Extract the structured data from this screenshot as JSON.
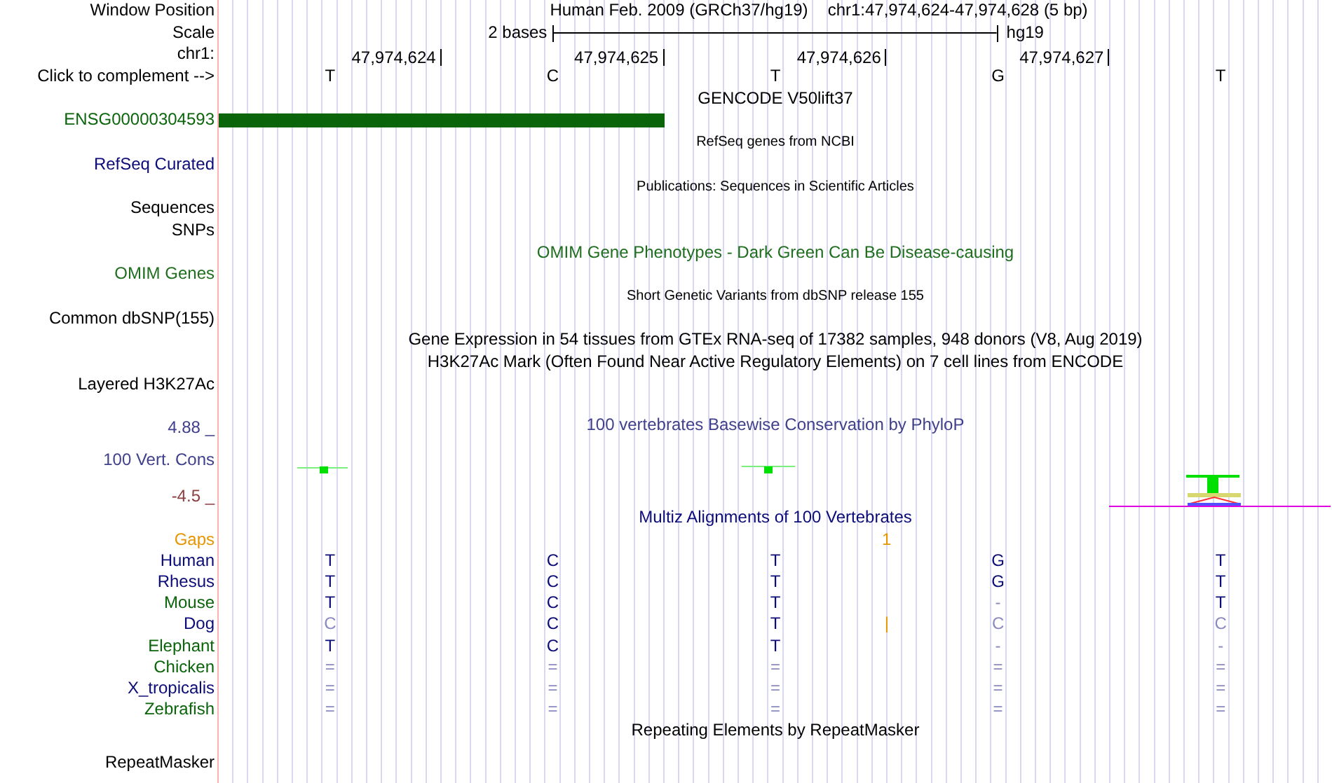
{
  "rows": [
    {
      "kind": "position",
      "label": "Window Position",
      "assembly": "Human Feb. 2009 (GRCh37/hg19)",
      "position": "chr1:47,974,624-47,974,628 (5 bp)"
    },
    {
      "kind": "scale",
      "label": "Scale",
      "span": "2 bases",
      "db": "hg19"
    },
    {
      "kind": "ruler",
      "label": "chr1:",
      "ticks": [
        "47,974,624",
        "47,974,625",
        "47,974,626",
        "47,974,627"
      ]
    },
    {
      "kind": "bases",
      "label": "Click to complement -->",
      "bases": [
        "T",
        "C",
        "T",
        "G",
        "T"
      ]
    },
    {
      "kind": "title",
      "text": "GENCODE V50lift37",
      "color": "#000000"
    },
    {
      "kind": "feature",
      "label": "ENSG00000304593",
      "color": "#0a640a",
      "level": 0.4
    },
    {
      "kind": "subtitle",
      "text": "RefSeq genes from NCBI"
    },
    {
      "kind": "label",
      "label": "RefSeq Curated",
      "color": "#0c0c78"
    },
    {
      "kind": "subtitle",
      "text": "Publications: Sequences in Scientific Articles"
    },
    {
      "kind": "label",
      "label": "Sequences",
      "color": "#000000"
    },
    {
      "kind": "label",
      "label": "SNPs",
      "color": "#000000"
    },
    {
      "kind": "title",
      "text": "OMIM Gene Phenotypes - Dark Green Can Be Disease-causing",
      "color": "#1e6e1e"
    },
    {
      "kind": "label",
      "label": "OMIM Genes",
      "color": "#1e6e1e"
    },
    {
      "kind": "subtitle",
      "text": "Short Genetic Variants from dbSNP release 155"
    },
    {
      "kind": "label",
      "label": "Common dbSNP(155)",
      "color": "#000000"
    },
    {
      "kind": "title",
      "text": "Gene Expression in 54 tissues from GTEx RNA-seq of 17382 samples, 948 donors (V8, Aug 2019)",
      "color": "#000000"
    },
    {
      "kind": "title",
      "text": "H3K27Ac Mark (Often Found Near Active Regulatory Elements) on 7 cell lines from ENCODE",
      "color": "#000000"
    },
    {
      "kind": "label",
      "label": "Layered H3K27Ac",
      "color": "#000000"
    },
    {
      "kind": "conservation",
      "label": "100 Vert. Cons",
      "color": "#40408c",
      "max": "4.88 _",
      "min": "-4.5 _",
      "text": "100 vertebrates Basewise Conservation by PhyloP"
    },
    {
      "kind": "title",
      "text": "Multiz Alignments of 100 Vertebrates",
      "color": "#0c0c78"
    },
    {
      "kind": "gaps",
      "label": "Gaps",
      "color": "#e69500",
      "insert": "1"
    },
    {
      "kind": "species",
      "label": "Human",
      "color": "#0c0c78",
      "bases": [
        {
          "text": "T",
          "faded": false
        },
        {
          "text": "C",
          "faded": false
        },
        {
          "text": "T",
          "faded": false
        },
        {
          "text": "G",
          "faded": false
        },
        {
          "text": "T",
          "faded": false
        }
      ]
    },
    {
      "kind": "species",
      "label": "Rhesus",
      "color": "#0c0c78",
      "bases": [
        {
          "text": "T",
          "faded": false
        },
        {
          "text": "C",
          "faded": false
        },
        {
          "text": "T",
          "faded": false
        },
        {
          "text": "G",
          "faded": false
        },
        {
          "text": "T",
          "faded": false
        }
      ]
    },
    {
      "kind": "species",
      "label": "Mouse",
      "color": "#0a640a",
      "bases": [
        {
          "text": "T",
          "faded": false
        },
        {
          "text": "C",
          "faded": false
        },
        {
          "text": "T",
          "faded": false
        },
        {
          "text": "-",
          "faded": true
        },
        {
          "text": "T",
          "faded": false
        }
      ]
    },
    {
      "kind": "species",
      "label": "Dog",
      "color": "#0c0c78",
      "insert": "|",
      "bases": [
        {
          "text": "C",
          "faded": true
        },
        {
          "text": "C",
          "faded": false
        },
        {
          "text": "T",
          "faded": false
        },
        {
          "text": "C",
          "faded": true
        },
        {
          "text": "C",
          "faded": true
        }
      ]
    },
    {
      "kind": "species",
      "label": "Elephant",
      "color": "#0a640a",
      "bases": [
        {
          "text": "T",
          "faded": false
        },
        {
          "text": "C",
          "faded": false
        },
        {
          "text": "T",
          "faded": false
        },
        {
          "text": "-",
          "faded": true
        },
        {
          "text": "-",
          "faded": true
        }
      ]
    },
    {
      "kind": "species",
      "label": "Chicken",
      "color": "#0a640a",
      "bases": [
        {
          "text": "=",
          "faded": true
        },
        {
          "text": "=",
          "faded": true
        },
        {
          "text": "=",
          "faded": true
        },
        {
          "text": "=",
          "faded": true
        },
        {
          "text": "=",
          "faded": true
        }
      ]
    },
    {
      "kind": "species",
      "label": "X_tropicalis",
      "color": "#0c0c78",
      "bases": [
        {
          "text": "=",
          "faded": true
        },
        {
          "text": "=",
          "faded": true
        },
        {
          "text": "=",
          "faded": true
        },
        {
          "text": "=",
          "faded": true
        },
        {
          "text": "=",
          "faded": true
        }
      ]
    },
    {
      "kind": "species",
      "label": "Zebrafish",
      "color": "#0a640a",
      "bases": [
        {
          "text": "=",
          "faded": true
        },
        {
          "text": "=",
          "faded": true
        },
        {
          "text": "=",
          "faded": true
        },
        {
          "text": "=",
          "faded": true
        },
        {
          "text": "=",
          "faded": true
        }
      ]
    },
    {
      "kind": "title",
      "text": "Repeating Elements by RepeatMasker",
      "color": "#000000"
    },
    {
      "kind": "label",
      "label": "RepeatMasker",
      "color": "#000000"
    }
  ]
}
